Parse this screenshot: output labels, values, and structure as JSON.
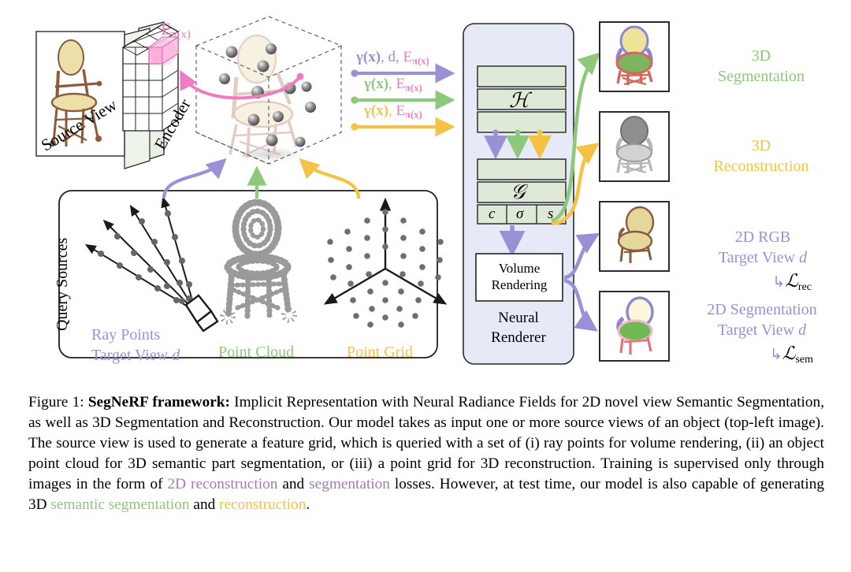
{
  "figure": {
    "left_panel": {
      "source_view_label": "Source View",
      "encoder_label": "Encoder",
      "feature_label_main": "E",
      "feature_label_sub": "π(x)"
    },
    "query_panel": {
      "title": "Query Sources",
      "items": [
        {
          "name": "ray-points",
          "line1": "Ray Points",
          "line2": "Target View",
          "italic": "d",
          "color": "#9a90d6"
        },
        {
          "name": "point-cloud",
          "line1": "Point Cloud",
          "line2": "",
          "italic": "",
          "color": "#8dc87b"
        },
        {
          "name": "point-grid",
          "line1": "Point Grid",
          "line2": "",
          "italic": "",
          "color": "#f6c245"
        }
      ]
    },
    "arrows": [
      {
        "name": "ray-arrow",
        "gamma": "γ(x)",
        "mid": ", d, ",
        "enc": "E",
        "enc_sub": "π(x)",
        "color": "#9a90d6"
      },
      {
        "name": "cloud-arrow",
        "gamma": "γ(x)",
        "mid": ", ",
        "enc": "E",
        "enc_sub": "π(x)",
        "color": "#8dc87b"
      },
      {
        "name": "grid-arrow",
        "gamma": "γ(x)",
        "mid": ", ",
        "enc": "E",
        "enc_sub": "π(x)",
        "color": "#f6c245"
      }
    ],
    "renderer": {
      "title_line1": "Neural",
      "title_line2": "Renderer",
      "mlp_h": "ℋ",
      "mlp_g": "𝒢",
      "outputs": [
        "c",
        "σ",
        "s"
      ],
      "volume_line1": "Volume",
      "volume_line2": "Rendering"
    },
    "results": [
      {
        "name": "result-3d-segmentation",
        "line1": "3D",
        "line2": "Segmentation",
        "color": "#8dc87b",
        "loss": ""
      },
      {
        "name": "result-3d-reconstruction",
        "line1": "3D",
        "line2": "Reconstruction",
        "color": "#f6c245",
        "loss": ""
      },
      {
        "name": "result-2d-rgb",
        "line1": "2D RGB",
        "line2": "Target View",
        "italic": "d",
        "color": "#9a90d6",
        "loss_arrow": "↳",
        "loss": "ℒ",
        "loss_sub": "rec"
      },
      {
        "name": "result-2d-segmentation",
        "line1": "2D Segmentation",
        "line2": "Target View",
        "italic": "d",
        "color": "#9a90d6",
        "loss_arrow": "↳",
        "loss": "ℒ",
        "loss_sub": "sem"
      }
    ],
    "colors": {
      "purple": "#9a90d6",
      "green": "#8dc87b",
      "yellow": "#f6c245",
      "pink": "#f07cc0",
      "renderer_bg": "#e6eaf7",
      "layer_fill": "#dfe9d8"
    }
  },
  "caption": {
    "prefix": "Figure 1: ",
    "bold": "SegNeRF framework:",
    "t1": " Implicit Representation with Neural Radiance Fields for 2D novel view Semantic Segmentation, as well as 3D Segmentation and Reconstruction. Our model takes as input one or more source views of an object (top-left image). The source view is used to generate a feature grid, which is queried with a set of (i) ray points for volume rendering, (ii) an object point cloud for 3D semantic part segmentation, or (iii) a point grid for 3D reconstruction. Training is supervised only through images in the form of ",
    "c1": "2D reconstruction",
    "t2": " and ",
    "c2": "segmentation",
    "t3": " losses. However, at test time, our model is also capable of generating 3D ",
    "c3": "semantic segmentation",
    "t4": " and ",
    "c4": "reconstruction",
    "t5": "."
  }
}
